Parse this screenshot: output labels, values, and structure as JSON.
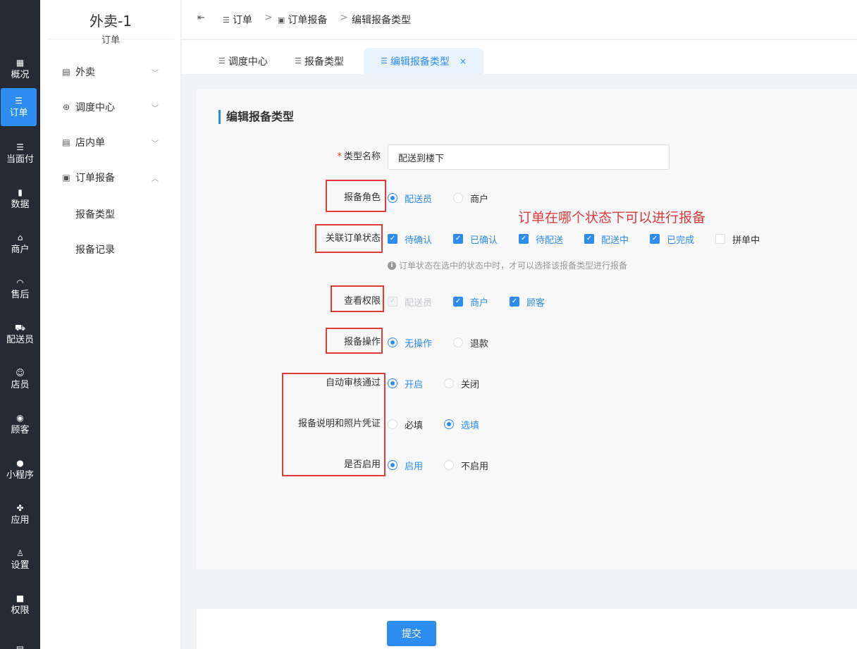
{
  "rail": {
    "items": [
      {
        "label": "概况",
        "icon": "dashboard-icon",
        "glyph": "▦",
        "active": false
      },
      {
        "label": "订单",
        "icon": "list-icon",
        "glyph": "☰",
        "active": true
      },
      {
        "label": "当面付",
        "icon": "list-icon",
        "glyph": "☰",
        "active": false
      },
      {
        "label": "数据",
        "icon": "bar-chart-icon",
        "glyph": "▮",
        "active": false
      },
      {
        "label": "商户",
        "icon": "store-icon",
        "glyph": "⌂",
        "active": false
      },
      {
        "label": "售后",
        "icon": "headset-icon",
        "glyph": "◠",
        "active": false
      },
      {
        "label": "配送员",
        "icon": "delivery-scooter-icon",
        "glyph": "⛟",
        "active": false
      },
      {
        "label": "店员",
        "icon": "users-icon",
        "glyph": "☺",
        "active": false
      },
      {
        "label": "顾客",
        "icon": "customer-icon",
        "glyph": "◉",
        "active": false
      },
      {
        "label": "小程序",
        "icon": "wechat-icon",
        "glyph": "●",
        "active": false
      },
      {
        "label": "应用",
        "icon": "apps-icon",
        "glyph": "✤",
        "active": false
      },
      {
        "label": "设置",
        "icon": "settings-user-icon",
        "glyph": "♙",
        "active": false
      },
      {
        "label": "权限",
        "icon": "lock-icon",
        "glyph": "■",
        "active": false
      },
      {
        "label": "",
        "icon": "report-icon",
        "glyph": "▤",
        "active": false
      }
    ]
  },
  "subnav": {
    "title": "外卖-1",
    "subtitle": "订单",
    "groups": [
      {
        "label": "外卖",
        "icon": "document-icon",
        "glyph": "▤",
        "chevron": "﹀"
      },
      {
        "label": "调度中心",
        "icon": "location-icon",
        "glyph": "⊕",
        "chevron": "﹀"
      },
      {
        "label": "店内单",
        "icon": "document-icon",
        "glyph": "▤",
        "chevron": "﹀"
      },
      {
        "label": "订单报备",
        "icon": "report-icon",
        "glyph": "▣",
        "chevron": "︿"
      }
    ],
    "sub_items": [
      "报备类型",
      "报备记录"
    ]
  },
  "breadcrumb": {
    "items": [
      "订单",
      "订单报备",
      "编辑报备类型"
    ],
    "separator": ">"
  },
  "tabs": [
    {
      "label": "调度中心",
      "active": false
    },
    {
      "label": "报备类型",
      "active": false
    },
    {
      "label": "编辑报备类型",
      "active": true,
      "close": "×"
    }
  ],
  "form": {
    "section_title": "编辑报备类型",
    "name": {
      "label": "类型名称",
      "required_mark": "*",
      "value": "配送到楼下"
    },
    "role": {
      "label": "报备角色",
      "options": [
        "配送员",
        "商户"
      ],
      "selected": 0
    },
    "order_status": {
      "label": "关联订单状态",
      "options": [
        "待确认",
        "已确认",
        "待配送",
        "配送中",
        "已完成",
        "拼单中"
      ],
      "checked": [
        true,
        true,
        true,
        true,
        true,
        false
      ]
    },
    "status_hint": "订单状态在选中的状态中时，才可以选择该报备类型进行报备",
    "view_permission": {
      "label": "查看权限",
      "options": [
        "配送员",
        "商户",
        "顾客"
      ],
      "checked": [
        true,
        true,
        true
      ],
      "disabled": [
        true,
        false,
        false
      ]
    },
    "operation": {
      "label": "报备操作",
      "options": [
        "无操作",
        "退款"
      ],
      "selected": 0
    },
    "auto_approve": {
      "label": "自动审核通过",
      "options": [
        "开启",
        "关闭"
      ],
      "selected": 0
    },
    "note_photo": {
      "label": "报备说明和照片凭证",
      "options": [
        "必填",
        "选填"
      ],
      "selected": 1
    },
    "enabled": {
      "label": "是否启用",
      "options": [
        "启用",
        "不启用"
      ],
      "selected": 0
    }
  },
  "annotation": {
    "text": "订单在哪个状态下可以进行报备",
    "color": "#e03a3a"
  },
  "footer": {
    "submit_label": "提交"
  },
  "colors": {
    "accent": "#2d8cf0",
    "rail_bg": "#252a34",
    "required": "#ed4014"
  }
}
